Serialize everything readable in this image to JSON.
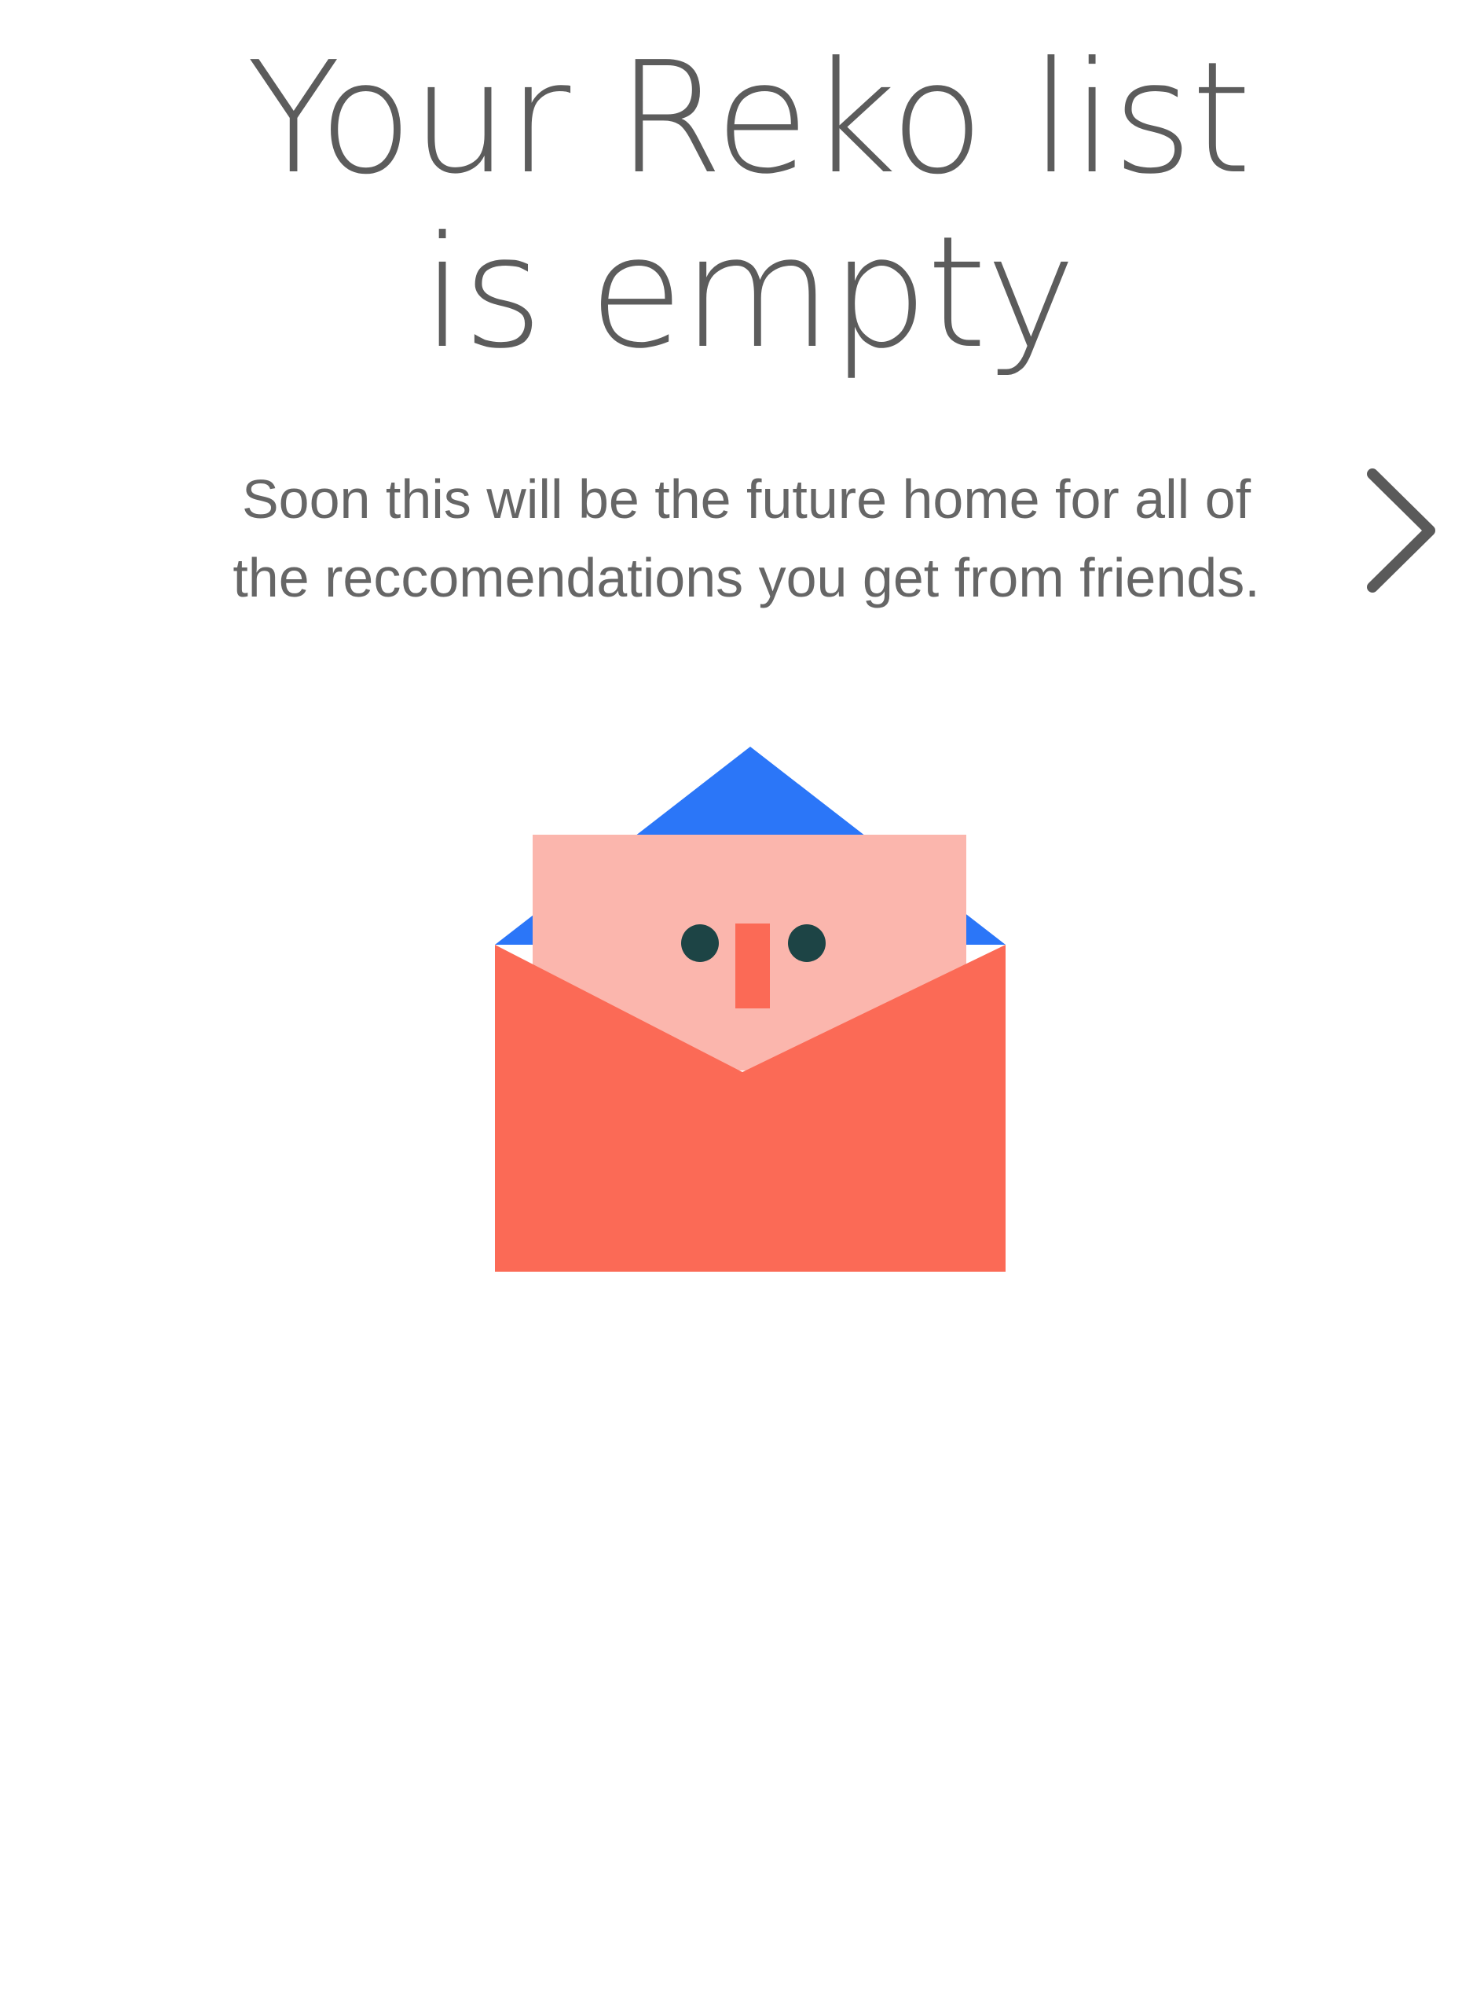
{
  "empty_state": {
    "title_line1": "Your Reko list",
    "title_line2": "is empty",
    "description_line1": "Soon this will be the future home for all of",
    "description_line2": "the reccomendations you get from friends."
  },
  "icons": {
    "next": "chevron-right-icon",
    "illustration": "envelope-letter-face-illustration"
  },
  "colors": {
    "title_text": "#5c5c5c",
    "body_text": "#666666",
    "envelope_body": "#fb6a56",
    "envelope_flap_inside": "#2b76f8",
    "letter": "#fbb6ad",
    "face_eyes": "#1d4445",
    "face_nose": "#fb6a56",
    "chevron": "#5a5a5a"
  }
}
